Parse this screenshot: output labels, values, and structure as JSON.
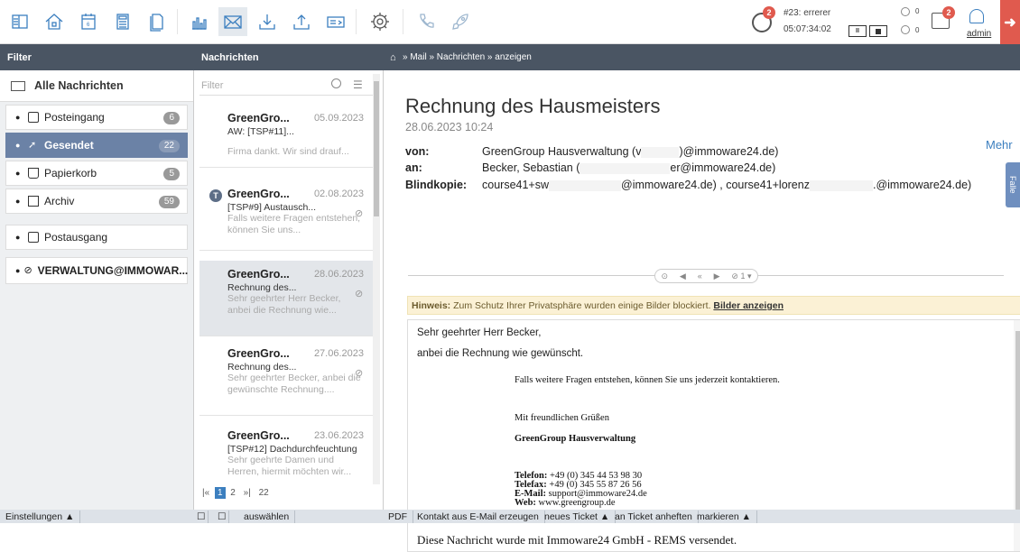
{
  "toolbar": {
    "timer_count": "2",
    "ticket_label": "#23: errerer",
    "timer_time": "05:07:34:02",
    "counter_a": "0",
    "counter_b": "0",
    "messages_count": "2",
    "user_name": "admin"
  },
  "panels": {
    "filter_title": "Filter",
    "messages_title": "Nachrichten",
    "breadcrumb": "» Mail » Nachrichten » anzeigen"
  },
  "filter": {
    "all_label": "Alle Nachrichten",
    "items": [
      {
        "label": "Posteingang",
        "count": "6"
      },
      {
        "label": "Gesendet",
        "count": "22"
      },
      {
        "label": "Papierkorb",
        "count": "5"
      },
      {
        "label": "Archiv",
        "count": "59"
      },
      {
        "label": "Postausgang",
        "count": ""
      },
      {
        "label": "VERWALTUNG@IMMOWAR...",
        "count": ""
      }
    ]
  },
  "messages": {
    "search_placeholder": "Filter",
    "items": [
      {
        "from": "GreenGro...",
        "date": "05.09.2023",
        "subject": "AW: [TSP#11]...",
        "preview": "Firma dankt. Wir sind drauf..."
      },
      {
        "from": "GreenGro...",
        "date": "02.08.2023",
        "subject": "[TSP#9] Austausch...",
        "preview": "Falls weitere Fragen entstehen, können Sie uns..."
      },
      {
        "from": "GreenGro...",
        "date": "28.06.2023",
        "subject": "Rechnung des...",
        "preview": "Sehr geehrter Herr Becker, anbei die Rechnung wie..."
      },
      {
        "from": "GreenGro...",
        "date": "27.06.2023",
        "subject": "Rechnung des...",
        "preview": "Sehr geehrter Becker, anbei die gewünschte Rechnung...."
      },
      {
        "from": "GreenGro...",
        "date": "23.06.2023",
        "subject": "[TSP#12] Dachdurchfeuchtung",
        "preview": "Sehr geehrte Damen und Herren, hiermit möchten wir..."
      }
    ],
    "badge": "T",
    "pager": {
      "first": "|«",
      "p1": "1",
      "p2": "2",
      "last": "»|",
      "total": "22"
    }
  },
  "detail": {
    "title": "Rechnung des Hausmeisters",
    "date": "28.06.2023 10:24",
    "from_label": "von:",
    "from_value_a": "GreenGroup Hausverwaltung (v",
    "from_value_b": ")@immoware24.de)",
    "to_label": "an:",
    "to_value_a": "Becker, Sebastian (",
    "to_value_b": "er@immoware24.de)",
    "bcc_label": "Blindkopie:",
    "bcc_value_a": "course41+sw",
    "bcc_value_b": "@immoware24.de) , course41+lorenz",
    "bcc_value_c": ".@immoware24.de)",
    "more": "Mehr",
    "side_tab": "Falle",
    "attach_count": "1",
    "notice_bold": "Hinweis:",
    "notice_text": " Zum Schutz Ihrer Privatsphäre wurden einige Bilder blockiert. ",
    "notice_link": "Bilder anzeigen",
    "body": {
      "greeting": "Sehr geehrter Herr Becker,",
      "line1": "anbei die Rechnung wie gewünscht.",
      "line2": "Falls weitere Fragen entstehen, können Sie uns jederzeit kontaktieren.",
      "regards": "Mit freundlichen Grüßen",
      "company": "GreenGroup Hausverwaltung",
      "phone_label": "Telefon:",
      "phone": " +49 (0) 345 44 53 98 30",
      "fax_label": "Telefax:",
      "fax": " +49 (0) 345 55 87 26 56",
      "mail_label": "E-Mail:",
      "mail": " support@immoware24.de",
      "web_label": "Web:",
      "web": " www.greengroup.de",
      "footer": "Diese Nachricht wurde mit Immoware24 GmbH - REMS versendet."
    }
  },
  "statusbar": {
    "settings": "Einstellungen ▲",
    "select": "auswählen",
    "pdf": "PDF",
    "contact": "Kontakt aus E-Mail erzeugen",
    "new_ticket": "neues Ticket ▲",
    "attach_ticket": "an Ticket anheften",
    "mark": "markieren ▲"
  },
  "colors": {
    "accent": "#3c7fbf",
    "header_bar": "#4a5563",
    "active_filter": "#6b82a6",
    "logout": "#e05a4e",
    "badge_red": "#e05a4e"
  }
}
